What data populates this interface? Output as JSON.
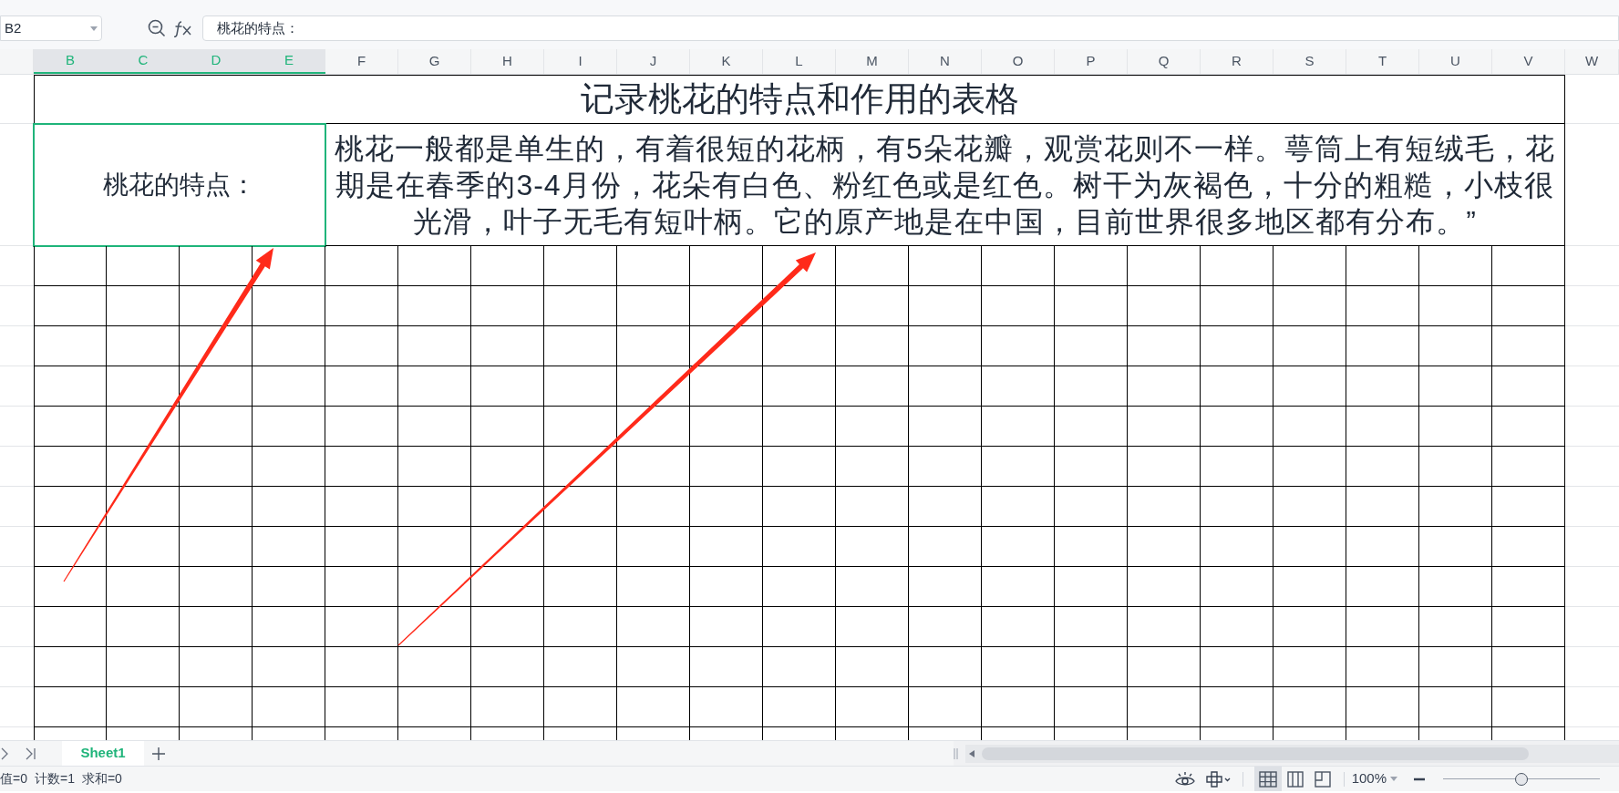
{
  "name_box": {
    "value": "B2"
  },
  "formula_bar": {
    "value": "桃花的特点："
  },
  "column_headers": [
    {
      "label": "B",
      "selected": true
    },
    {
      "label": "C",
      "selected": true
    },
    {
      "label": "D",
      "selected": true
    },
    {
      "label": "E",
      "selected": true
    },
    {
      "label": "F",
      "selected": false
    },
    {
      "label": "G",
      "selected": false
    },
    {
      "label": "H",
      "selected": false
    },
    {
      "label": "I",
      "selected": false
    },
    {
      "label": "J",
      "selected": false
    },
    {
      "label": "K",
      "selected": false
    },
    {
      "label": "L",
      "selected": false
    },
    {
      "label": "M",
      "selected": false
    },
    {
      "label": "N",
      "selected": false
    },
    {
      "label": "O",
      "selected": false
    },
    {
      "label": "P",
      "selected": false
    },
    {
      "label": "Q",
      "selected": false
    },
    {
      "label": "R",
      "selected": false
    },
    {
      "label": "S",
      "selected": false
    },
    {
      "label": "T",
      "selected": false
    },
    {
      "label": "U",
      "selected": false
    },
    {
      "label": "V",
      "selected": false
    },
    {
      "label": "W",
      "selected": false
    }
  ],
  "title_cell": {
    "text": "记录桃花的特点和作用的表格"
  },
  "label_cell": {
    "text": "桃花的特点：",
    "selected": true
  },
  "text_cell": {
    "text": "桃花一般都是单生的，有着很短的花柄，有5朵花瓣，观赏花则不一样。萼筒上有短绒毛，花期是在春季的3-4月份，花朵有白色、粉红色或是红色。树干为灰褐色，十分的粗糙，小枝很光滑，叶子无毛有短叶柄。它的原产地是在中国，目前世界很多地区都有分布。”",
    "selected": false
  },
  "sheet_tabs": [
    {
      "label": "Sheet1",
      "selected": true
    }
  ],
  "status_bar": {
    "stats": [
      "值=0",
      "计数=1",
      "求和=0"
    ],
    "zoom": "100%",
    "zoom_slider": {
      "level": 0.5
    },
    "views": [
      {
        "kind": "normal",
        "selected": true
      },
      {
        "kind": "page",
        "selected": false
      },
      {
        "kind": "break",
        "selected": false
      }
    ]
  }
}
